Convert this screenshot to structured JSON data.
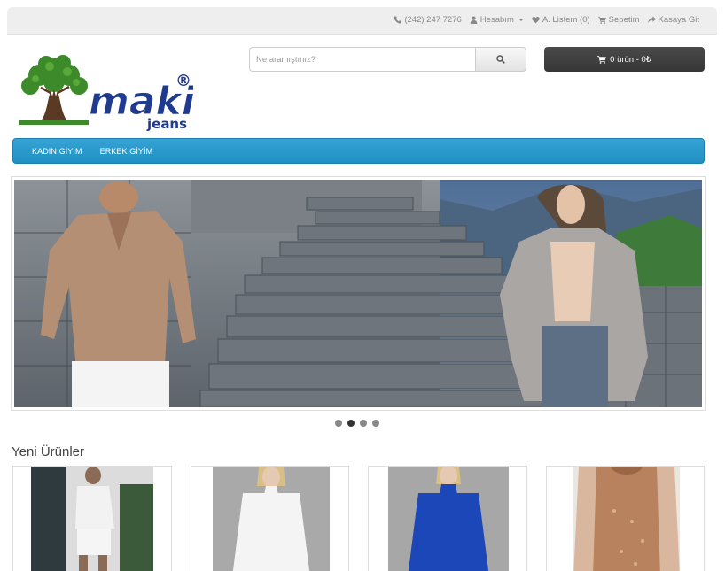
{
  "topbar": {
    "phone": "(242) 247 7276",
    "account": "Hesabım",
    "wishlist": "A. Listem (0)",
    "cart": "Sepetim",
    "checkout": "Kasaya Git"
  },
  "logo": {
    "brand": "maki",
    "sub": "jeans",
    "registered": "®"
  },
  "search": {
    "placeholder": "Ne aramıştınız?"
  },
  "cart_button": {
    "label": "0 ürün - 0₺"
  },
  "menu": {
    "items": [
      {
        "label": "KADIN GİYİM"
      },
      {
        "label": "ERKEK GİYİM"
      }
    ]
  },
  "slider": {
    "slide_count": 4,
    "active_index": 1
  },
  "products_section": {
    "title": "Yeni Ürünler"
  },
  "colors": {
    "menu_blue": "#2a9bcf",
    "cart_dark": "#3a3a3a",
    "logo_blue": "#1f3b8f"
  }
}
